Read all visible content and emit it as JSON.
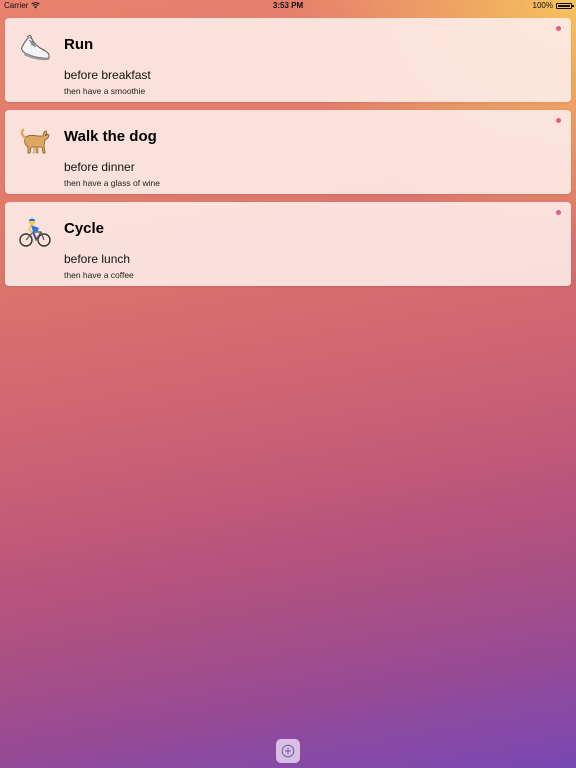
{
  "status_bar": {
    "carrier": "Carrier",
    "time": "3:53 PM",
    "battery": "100%"
  },
  "colors": {
    "accent_dot": "#e35b87",
    "card_background": "#fdece8"
  },
  "items": [
    {
      "icon": "running-shoe-icon",
      "title": "Run",
      "when": "before breakfast",
      "then": "then have a smoothie"
    },
    {
      "icon": "dog-icon",
      "title": "Walk the dog",
      "when": "before dinner",
      "then": "then have a glass of wine"
    },
    {
      "icon": "cyclist-icon",
      "title": "Cycle",
      "when": "before lunch",
      "then": "then have a coffee"
    }
  ],
  "add_button": {
    "icon": "plus-circle-icon"
  }
}
